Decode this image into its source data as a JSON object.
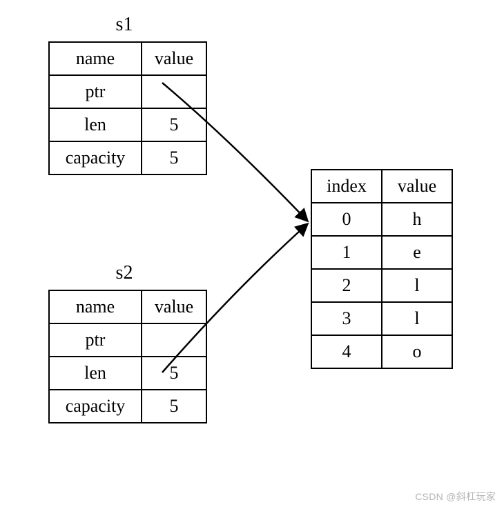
{
  "s1": {
    "title": "s1",
    "header": {
      "name": "name",
      "value": "value"
    },
    "rows": [
      {
        "name": "ptr",
        "value": ""
      },
      {
        "name": "len",
        "value": "5"
      },
      {
        "name": "capacity",
        "value": "5"
      }
    ]
  },
  "s2": {
    "title": "s2",
    "header": {
      "name": "name",
      "value": "value"
    },
    "rows": [
      {
        "name": "ptr",
        "value": ""
      },
      {
        "name": "len",
        "value": "5"
      },
      {
        "name": "capacity",
        "value": "5"
      }
    ]
  },
  "heap": {
    "header": {
      "index": "index",
      "value": "value"
    },
    "rows": [
      {
        "index": "0",
        "value": "h"
      },
      {
        "index": "1",
        "value": "e"
      },
      {
        "index": "2",
        "value": "l"
      },
      {
        "index": "3",
        "value": "l"
      },
      {
        "index": "4",
        "value": "o"
      }
    ]
  },
  "watermark": "CSDN @斜杠玩家"
}
